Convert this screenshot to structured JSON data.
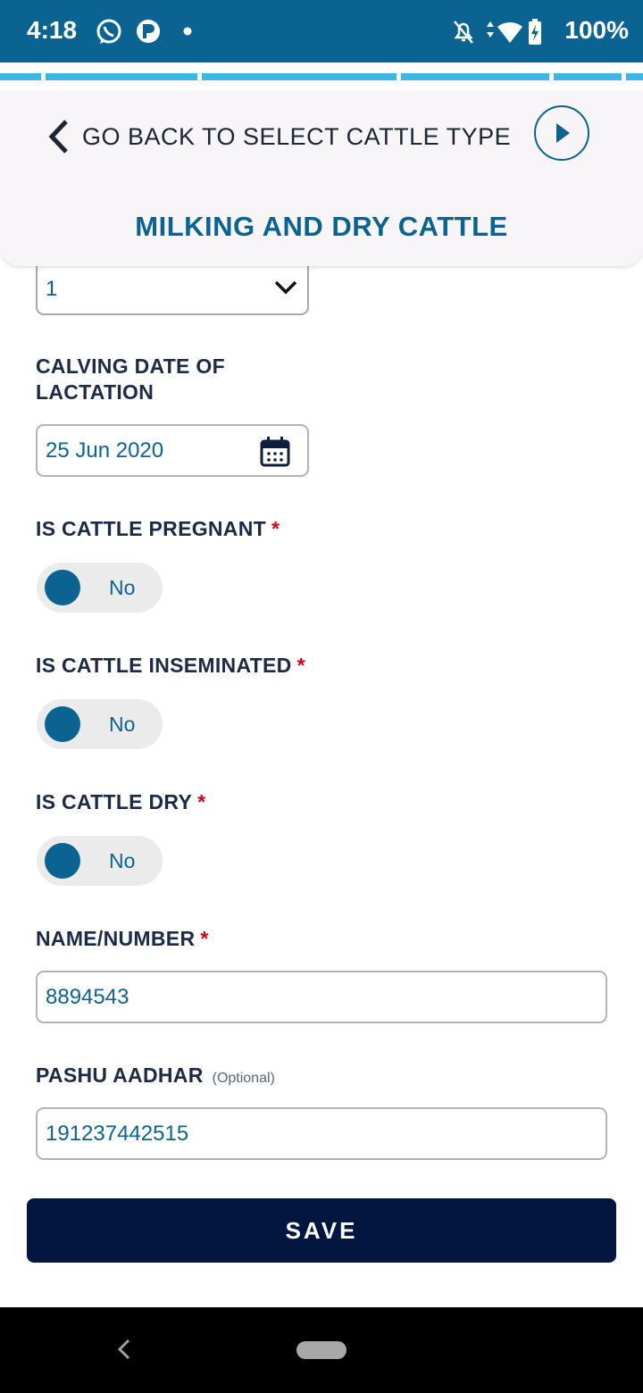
{
  "status_bar": {
    "time": "4:18",
    "battery": "100%",
    "left_icons": [
      "whatsapp-icon",
      "p-app-icon",
      "dot-icon"
    ],
    "right_icons": [
      "bell-off-icon",
      "data-arrows-icon",
      "wifi-icon",
      "battery-charging-icon"
    ]
  },
  "header": {
    "back_label": "GO BACK TO SELECT CATTLE TYPE",
    "title": "MILKING AND DRY CATTLE"
  },
  "form": {
    "lactation_select": {
      "value": "1"
    },
    "calving_date": {
      "label": "CALVING DATE OF\nLACTATION",
      "value": "25 Jun 2020"
    },
    "pregnant": {
      "label": "IS CATTLE PREGNANT",
      "required": "*",
      "value": "No"
    },
    "inseminated": {
      "label": "IS CATTLE INSEMINATED",
      "required": "*",
      "value": "No"
    },
    "dry": {
      "label": "IS CATTLE DRY",
      "required": "*",
      "value": "No"
    },
    "name_number": {
      "label": "NAME/NUMBER",
      "required": "*",
      "value": "8894543"
    },
    "pashu_aadhar": {
      "label": "PASHU AADHAR",
      "optional": "(Optional)",
      "value": "191237442515"
    }
  },
  "save_label": "SAVE",
  "colors": {
    "primary": "#0a6391",
    "accent_strip": "#3cb6e8",
    "save_button": "#031640",
    "required": "#d0021b"
  }
}
